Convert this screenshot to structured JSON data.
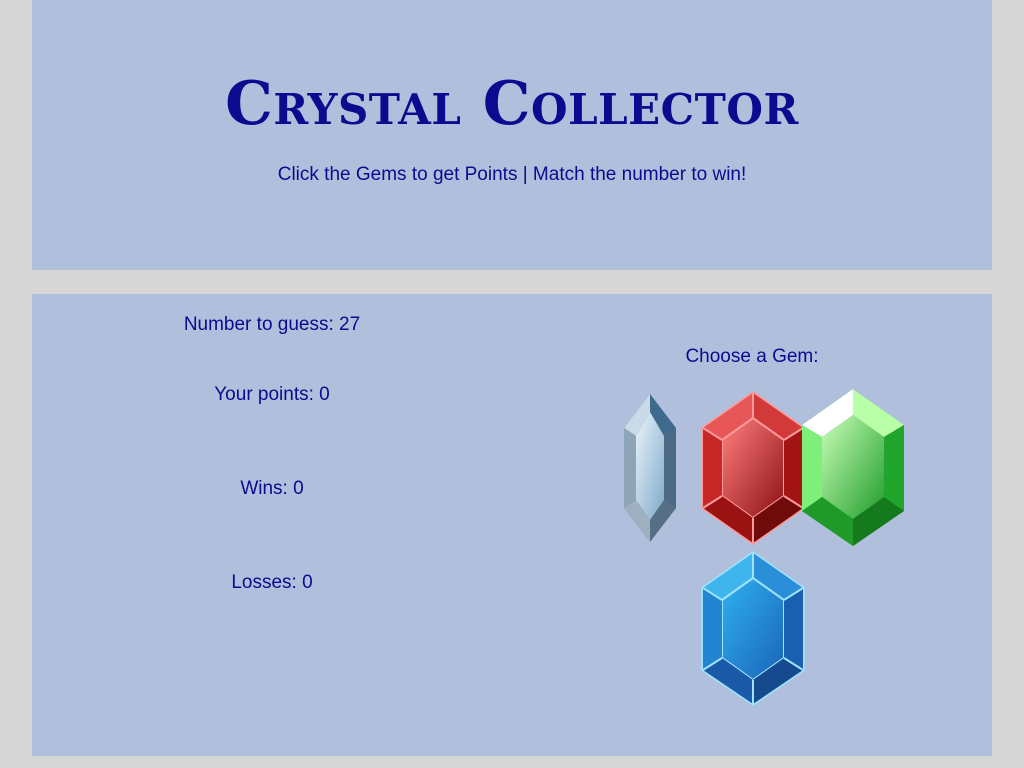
{
  "header": {
    "title": "Crystal Collector",
    "subtitle": "Click the Gems to get Points | Match the number to win!"
  },
  "stats": {
    "target": "Number to guess: 27",
    "points": "Your points: 0",
    "wins": "Wins: 0",
    "losses": "Losses: 0"
  },
  "gems": {
    "label": "Choose a Gem:",
    "items": [
      {
        "name": "crystal",
        "color": "#a9c8e0"
      },
      {
        "name": "ruby",
        "color": "#d93b3b"
      },
      {
        "name": "emerald",
        "color": "#33c233"
      },
      {
        "name": "sapphire",
        "color": "#1e8fd6"
      }
    ]
  },
  "colors": {
    "background": "#d6d6d6",
    "panel": "#b0bfdc",
    "text": "#0b0b8f"
  }
}
